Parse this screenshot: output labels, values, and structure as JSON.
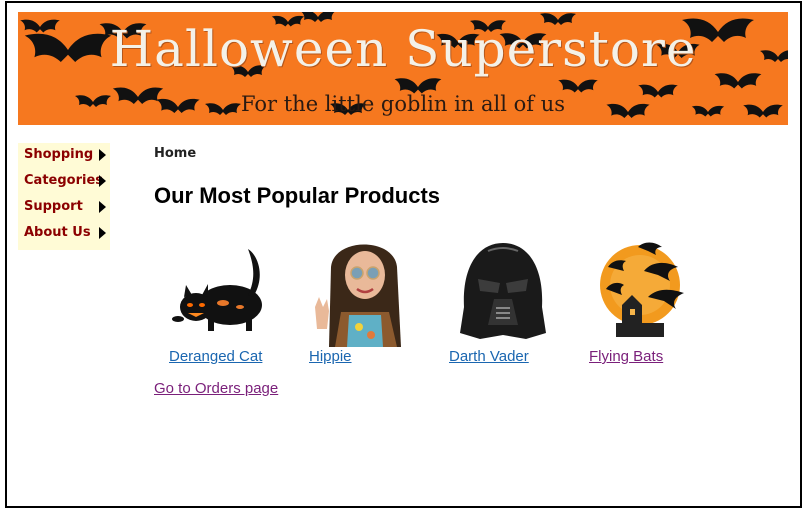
{
  "banner": {
    "title": "Halloween Superstore",
    "subtitle": "For the little goblin in all of us"
  },
  "menu": {
    "items": [
      {
        "label": "Shopping"
      },
      {
        "label": "Categories"
      },
      {
        "label": "Support"
      },
      {
        "label": "About Us"
      }
    ]
  },
  "breadcrumb": "Home",
  "page_title": "Our Most Popular Products",
  "products": [
    {
      "name": "Deranged Cat"
    },
    {
      "name": "Hippie"
    },
    {
      "name": "Darth Vader"
    },
    {
      "name": "Flying Bats"
    }
  ],
  "orders_link": "Go to Orders page",
  "colors": {
    "banner_bg": "#f6781f",
    "menu_bg": "#fffbd6",
    "menu_text": "#8b0000",
    "link": "#1a66b0",
    "visited_link": "#7a1f7a"
  }
}
